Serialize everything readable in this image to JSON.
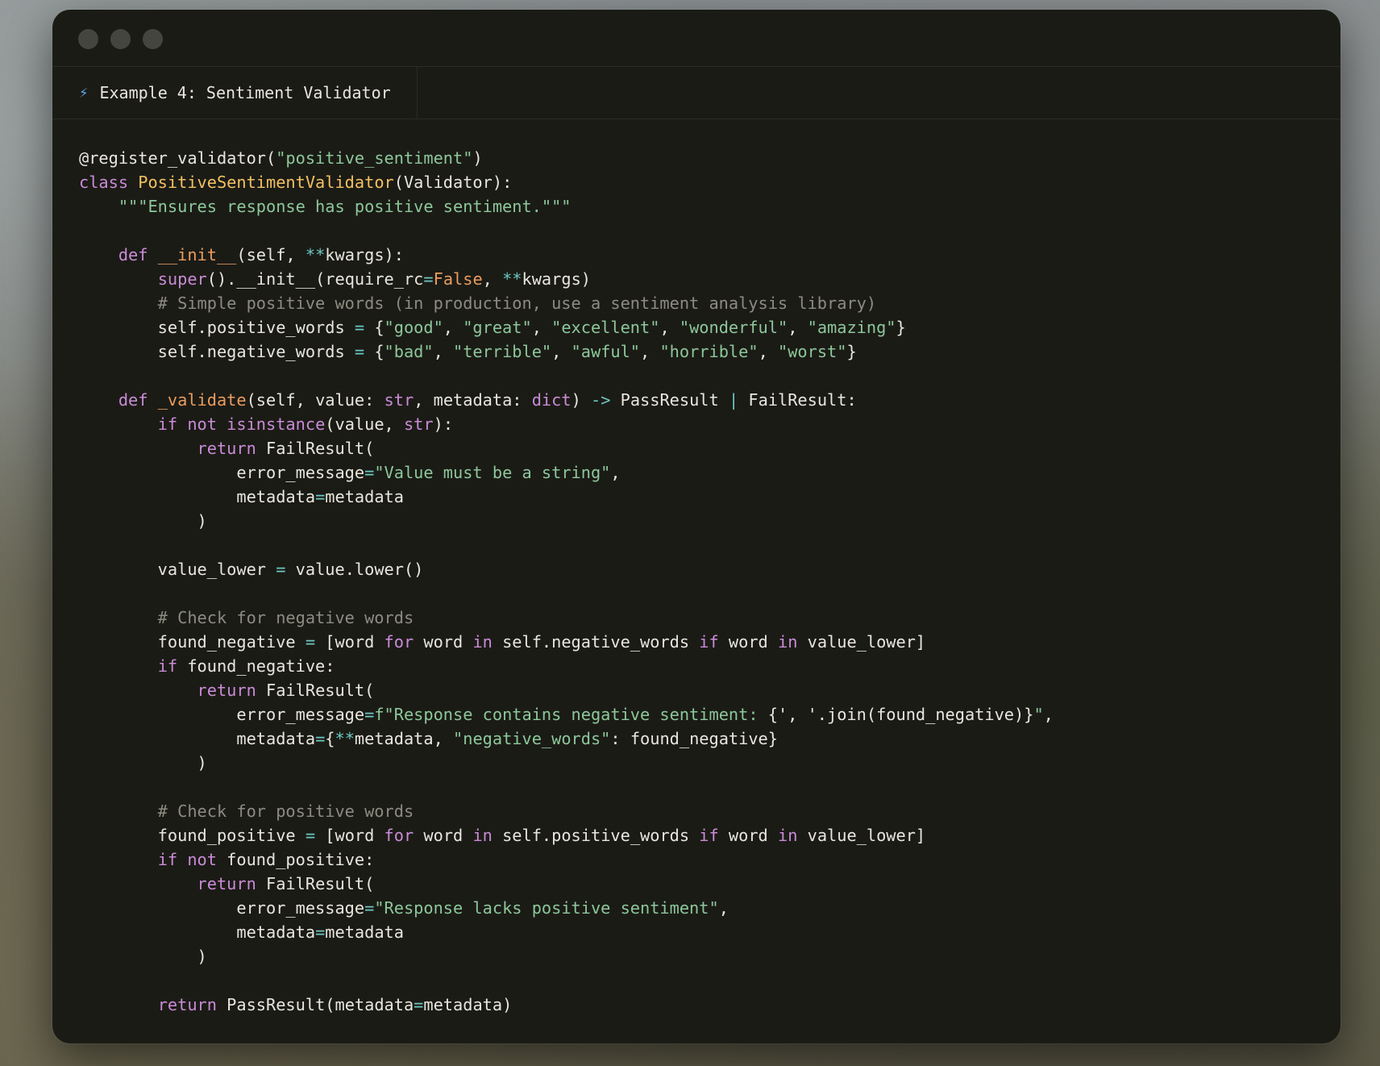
{
  "window": {
    "title_tab": "Example 4: Sentiment Validator",
    "tab_icon": "lightning-bolt-icon",
    "controls": [
      "close-dot",
      "minimize-dot",
      "maximize-dot"
    ]
  },
  "colors": {
    "background_window": "#1b1b16",
    "keyword": "#c98bd6",
    "string": "#8cc79a",
    "class_name": "#f2c061",
    "function_name": "#e89c5f",
    "comment": "#8d8b80",
    "operator": "#6cc7c0",
    "text": "#e8e6dc"
  },
  "code": {
    "language": "python",
    "lines": [
      [
        [
          "t",
          "@register_validator("
        ],
        [
          "s",
          "\"positive_sentiment\""
        ],
        [
          "t",
          ")"
        ]
      ],
      [
        [
          "k",
          "class "
        ],
        [
          "c",
          "PositiveSentimentValidator"
        ],
        [
          "t",
          "(Validator):"
        ]
      ],
      [
        [
          "s",
          "    \"\"\"Ensures response has positive sentiment.\"\"\""
        ]
      ],
      [],
      [
        [
          "t",
          "    "
        ],
        [
          "k",
          "def "
        ],
        [
          "f",
          "__init__"
        ],
        [
          "t",
          "(self, "
        ],
        [
          "o",
          "**"
        ],
        [
          "t",
          "kwargs):"
        ]
      ],
      [
        [
          "t",
          "        "
        ],
        [
          "k",
          "super"
        ],
        [
          "t",
          "().__init__(require_rc"
        ],
        [
          "o",
          "="
        ],
        [
          "f",
          "False"
        ],
        [
          "t",
          ", "
        ],
        [
          "o",
          "**"
        ],
        [
          "t",
          "kwargs)"
        ]
      ],
      [
        [
          "m",
          "        # Simple positive words (in production, use a sentiment analysis library)"
        ]
      ],
      [
        [
          "t",
          "        self.positive_words "
        ],
        [
          "o",
          "="
        ],
        [
          "t",
          " {"
        ],
        [
          "s",
          "\"good\""
        ],
        [
          "t",
          ", "
        ],
        [
          "s",
          "\"great\""
        ],
        [
          "t",
          ", "
        ],
        [
          "s",
          "\"excellent\""
        ],
        [
          "t",
          ", "
        ],
        [
          "s",
          "\"wonderful\""
        ],
        [
          "t",
          ", "
        ],
        [
          "s",
          "\"amazing\""
        ],
        [
          "t",
          "}"
        ]
      ],
      [
        [
          "t",
          "        self.negative_words "
        ],
        [
          "o",
          "="
        ],
        [
          "t",
          " {"
        ],
        [
          "s",
          "\"bad\""
        ],
        [
          "t",
          ", "
        ],
        [
          "s",
          "\"terrible\""
        ],
        [
          "t",
          ", "
        ],
        [
          "s",
          "\"awful\""
        ],
        [
          "t",
          ", "
        ],
        [
          "s",
          "\"horrible\""
        ],
        [
          "t",
          ", "
        ],
        [
          "s",
          "\"worst\""
        ],
        [
          "t",
          "}"
        ]
      ],
      [],
      [
        [
          "t",
          "    "
        ],
        [
          "k",
          "def "
        ],
        [
          "f",
          "_validate"
        ],
        [
          "t",
          "(self, value: "
        ],
        [
          "k",
          "str"
        ],
        [
          "t",
          ", metadata: "
        ],
        [
          "k",
          "dict"
        ],
        [
          "t",
          ") "
        ],
        [
          "o",
          "->"
        ],
        [
          "t",
          " PassResult "
        ],
        [
          "o",
          "|"
        ],
        [
          "t",
          " FailResult:"
        ]
      ],
      [
        [
          "t",
          "        "
        ],
        [
          "k",
          "if not "
        ],
        [
          "k",
          "isinstance"
        ],
        [
          "t",
          "(value, "
        ],
        [
          "k",
          "str"
        ],
        [
          "t",
          "):"
        ]
      ],
      [
        [
          "t",
          "            "
        ],
        [
          "k",
          "return "
        ],
        [
          "t",
          "FailResult("
        ]
      ],
      [
        [
          "t",
          "                error_message"
        ],
        [
          "o",
          "="
        ],
        [
          "s",
          "\"Value must be a string\""
        ],
        [
          "t",
          ","
        ]
      ],
      [
        [
          "t",
          "                metadata"
        ],
        [
          "o",
          "="
        ],
        [
          "t",
          "metadata"
        ]
      ],
      [
        [
          "t",
          "            )"
        ]
      ],
      [],
      [
        [
          "t",
          "        value_lower "
        ],
        [
          "o",
          "="
        ],
        [
          "t",
          " value.lower()"
        ]
      ],
      [],
      [
        [
          "m",
          "        # Check for negative words"
        ]
      ],
      [
        [
          "t",
          "        found_negative "
        ],
        [
          "o",
          "="
        ],
        [
          "t",
          " [word "
        ],
        [
          "k",
          "for"
        ],
        [
          "t",
          " word "
        ],
        [
          "k",
          "in"
        ],
        [
          "t",
          " self.negative_words "
        ],
        [
          "k",
          "if"
        ],
        [
          "t",
          " word "
        ],
        [
          "k",
          "in"
        ],
        [
          "t",
          " value_lower]"
        ]
      ],
      [
        [
          "t",
          "        "
        ],
        [
          "k",
          "if"
        ],
        [
          "t",
          " found_negative:"
        ]
      ],
      [
        [
          "t",
          "            "
        ],
        [
          "k",
          "return "
        ],
        [
          "t",
          "FailResult("
        ]
      ],
      [
        [
          "t",
          "                error_message"
        ],
        [
          "o",
          "="
        ],
        [
          "s",
          "f\"Response contains negative sentiment: "
        ],
        [
          "t",
          "{', '.join(found_negative)}"
        ],
        [
          "s",
          "\""
        ],
        [
          "t",
          ","
        ]
      ],
      [
        [
          "t",
          "                metadata"
        ],
        [
          "o",
          "="
        ],
        [
          "t",
          "{"
        ],
        [
          "o",
          "**"
        ],
        [
          "t",
          "metadata, "
        ],
        [
          "s",
          "\"negative_words\""
        ],
        [
          "t",
          ": found_negative}"
        ]
      ],
      [
        [
          "t",
          "            )"
        ]
      ],
      [],
      [
        [
          "m",
          "        # Check for positive words"
        ]
      ],
      [
        [
          "t",
          "        found_positive "
        ],
        [
          "o",
          "="
        ],
        [
          "t",
          " [word "
        ],
        [
          "k",
          "for"
        ],
        [
          "t",
          " word "
        ],
        [
          "k",
          "in"
        ],
        [
          "t",
          " self.positive_words "
        ],
        [
          "k",
          "if"
        ],
        [
          "t",
          " word "
        ],
        [
          "k",
          "in"
        ],
        [
          "t",
          " value_lower]"
        ]
      ],
      [
        [
          "t",
          "        "
        ],
        [
          "k",
          "if not"
        ],
        [
          "t",
          " found_positive:"
        ]
      ],
      [
        [
          "t",
          "            "
        ],
        [
          "k",
          "return "
        ],
        [
          "t",
          "FailResult("
        ]
      ],
      [
        [
          "t",
          "                error_message"
        ],
        [
          "o",
          "="
        ],
        [
          "s",
          "\"Response lacks positive sentiment\""
        ],
        [
          "t",
          ","
        ]
      ],
      [
        [
          "t",
          "                metadata"
        ],
        [
          "o",
          "="
        ],
        [
          "t",
          "metadata"
        ]
      ],
      [
        [
          "t",
          "            )"
        ]
      ],
      [],
      [
        [
          "t",
          "        "
        ],
        [
          "k",
          "return "
        ],
        [
          "t",
          "PassResult(metadata"
        ],
        [
          "o",
          "="
        ],
        [
          "t",
          "metadata)"
        ]
      ]
    ]
  }
}
